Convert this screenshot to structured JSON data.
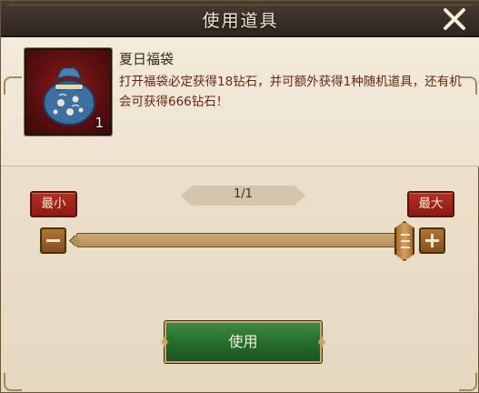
{
  "dialog": {
    "title": "使用道具",
    "close_icon": "close-x-icon"
  },
  "item": {
    "name": "夏日福袋",
    "description": "打开福袋必定获得18钻石，并可额外获得1种随机道具，还有机会可获得666钻石！",
    "count": "1",
    "icon": "lucky-bag-icon"
  },
  "quantity": {
    "display": "1/1",
    "current": 1,
    "max": 1,
    "slider_fraction": 1.0,
    "min_label": "最小",
    "max_label": "最大",
    "minus_icon": "minus-icon",
    "plus_icon": "plus-icon"
  },
  "actions": {
    "use_label": "使用"
  },
  "colors": {
    "header_bg": "#3a2f26",
    "panel_bg": "#ece2cd",
    "red_button": "#a02519",
    "green_button": "#2a6f2e",
    "description_text": "#6b2411"
  }
}
